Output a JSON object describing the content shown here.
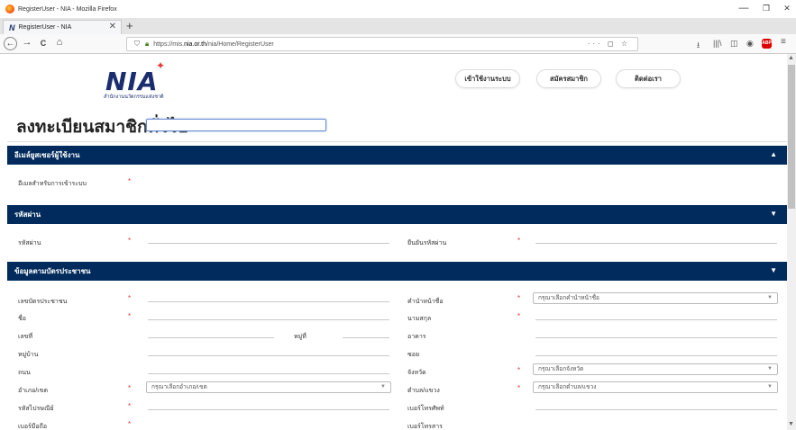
{
  "window": {
    "title": "RegisterUser - NIA - Mozilla Firefox",
    "minimize": "—",
    "maximize": "❐",
    "close": "✕"
  },
  "tab": {
    "label": "RegisterUser - NIA",
    "close": "✕",
    "new_tab": "+"
  },
  "nav": {
    "back": "←",
    "forward": "→",
    "reload": "C",
    "home": "⌂",
    "url_prefix": "https://mis.",
    "url_domain": "nia.or.th",
    "url_suffix": "/nia/Home/RegisterUser",
    "url_actions": "··· ◻ ☆",
    "download": "⭳",
    "library": "|||\\",
    "sidebar": "◫",
    "account": "◉",
    "abp": "ABP",
    "menu": "≡"
  },
  "site": {
    "logo_text": "NIA",
    "logo_sub": "สำนักงานนวัตกรรมแห่งชาติ",
    "buttons": [
      "เข้าใช้งานระบบ",
      "สมัครสมาชิก",
      "ติดต่อเรา"
    ]
  },
  "page": {
    "title": "ลงทะเบียนสมาชิกทั่วไป"
  },
  "sections": {
    "email": {
      "title": "อีเมล์ยูสเซอร์ผู้ใช้งาน",
      "chevron": "▲"
    },
    "password": {
      "title": "รหัสผ่าน",
      "chevron": "▼"
    },
    "idcard": {
      "title": "ข้อมูลตามบัตรประชาชน",
      "chevron": "▼"
    }
  },
  "fields": {
    "login_email": "อีเมลสำหรับการเข้าระบบ",
    "password": "รหัสผ่าน",
    "confirm_password": "ยืนยันรหัสผ่าน",
    "id_number": "เลขบัตรประชาชน",
    "prefix": "คำนำหน้าชื่อ",
    "first_name": "ชื่อ",
    "last_name": "นามสกุล",
    "house_no": "เลขที่",
    "moo": "หมู่ที่",
    "building": "อาคาร",
    "village": "หมู่บ้าน",
    "soi": "ซอย",
    "road": "ถนน",
    "province": "จังหวัด",
    "district": "อำเภอ/เขต",
    "subdistrict": "ตำบล/แขวง",
    "postcode": "รหัสไปรษณีย์",
    "phone": "เบอร์โทรศัพท์",
    "mobile": "เบอร์มือถือ",
    "fax": "เบอร์โทรสาร"
  },
  "selects": {
    "prefix": "กรุณาเลือกคำนำหน้าชื่อ",
    "province": "กรุณาเลือกจังหวัด",
    "district": "กรุณาเลือกอำเภอ/เขต",
    "subdistrict": "กรุณาเลือกตำบล/แขวง",
    "caret": "▼"
  },
  "required_mark": "*",
  "colors": {
    "section_bar": "#002b5c",
    "required": "#e53935",
    "logo": "#1a2d6e"
  }
}
